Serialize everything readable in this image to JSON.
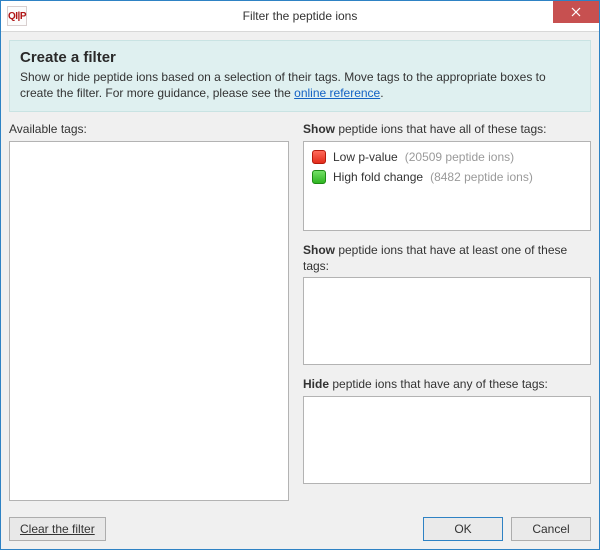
{
  "window": {
    "title": "Filter the peptide ions",
    "app_icon_text": "QI|P"
  },
  "info": {
    "heading": "Create a filter",
    "body_before_link": "Show or hide peptide ions based on a selection of their tags. Move tags to the appropriate boxes to create the filter. For more guidance, please see the ",
    "link_text": "online reference",
    "body_after_link": "."
  },
  "labels": {
    "available": "Available tags:",
    "show_all_prefix": "Show",
    "show_all_rest": " peptide ions that have all of these tags:",
    "show_any_prefix": "Show",
    "show_any_rest": " peptide ions that have at least one of these tags:",
    "hide_prefix": "Hide",
    "hide_rest": " peptide ions that have any of these tags:"
  },
  "tags_show_all": [
    {
      "swatch": "red",
      "name": "Low p-value",
      "count_text": "(20509 peptide ions)"
    },
    {
      "swatch": "green",
      "name": "High fold change",
      "count_text": "(8482 peptide ions)"
    }
  ],
  "buttons": {
    "clear": "Clear the filter",
    "ok": "OK",
    "cancel": "Cancel"
  },
  "box_heights": {
    "show_all": 90,
    "show_any": 88,
    "hide": 88
  }
}
